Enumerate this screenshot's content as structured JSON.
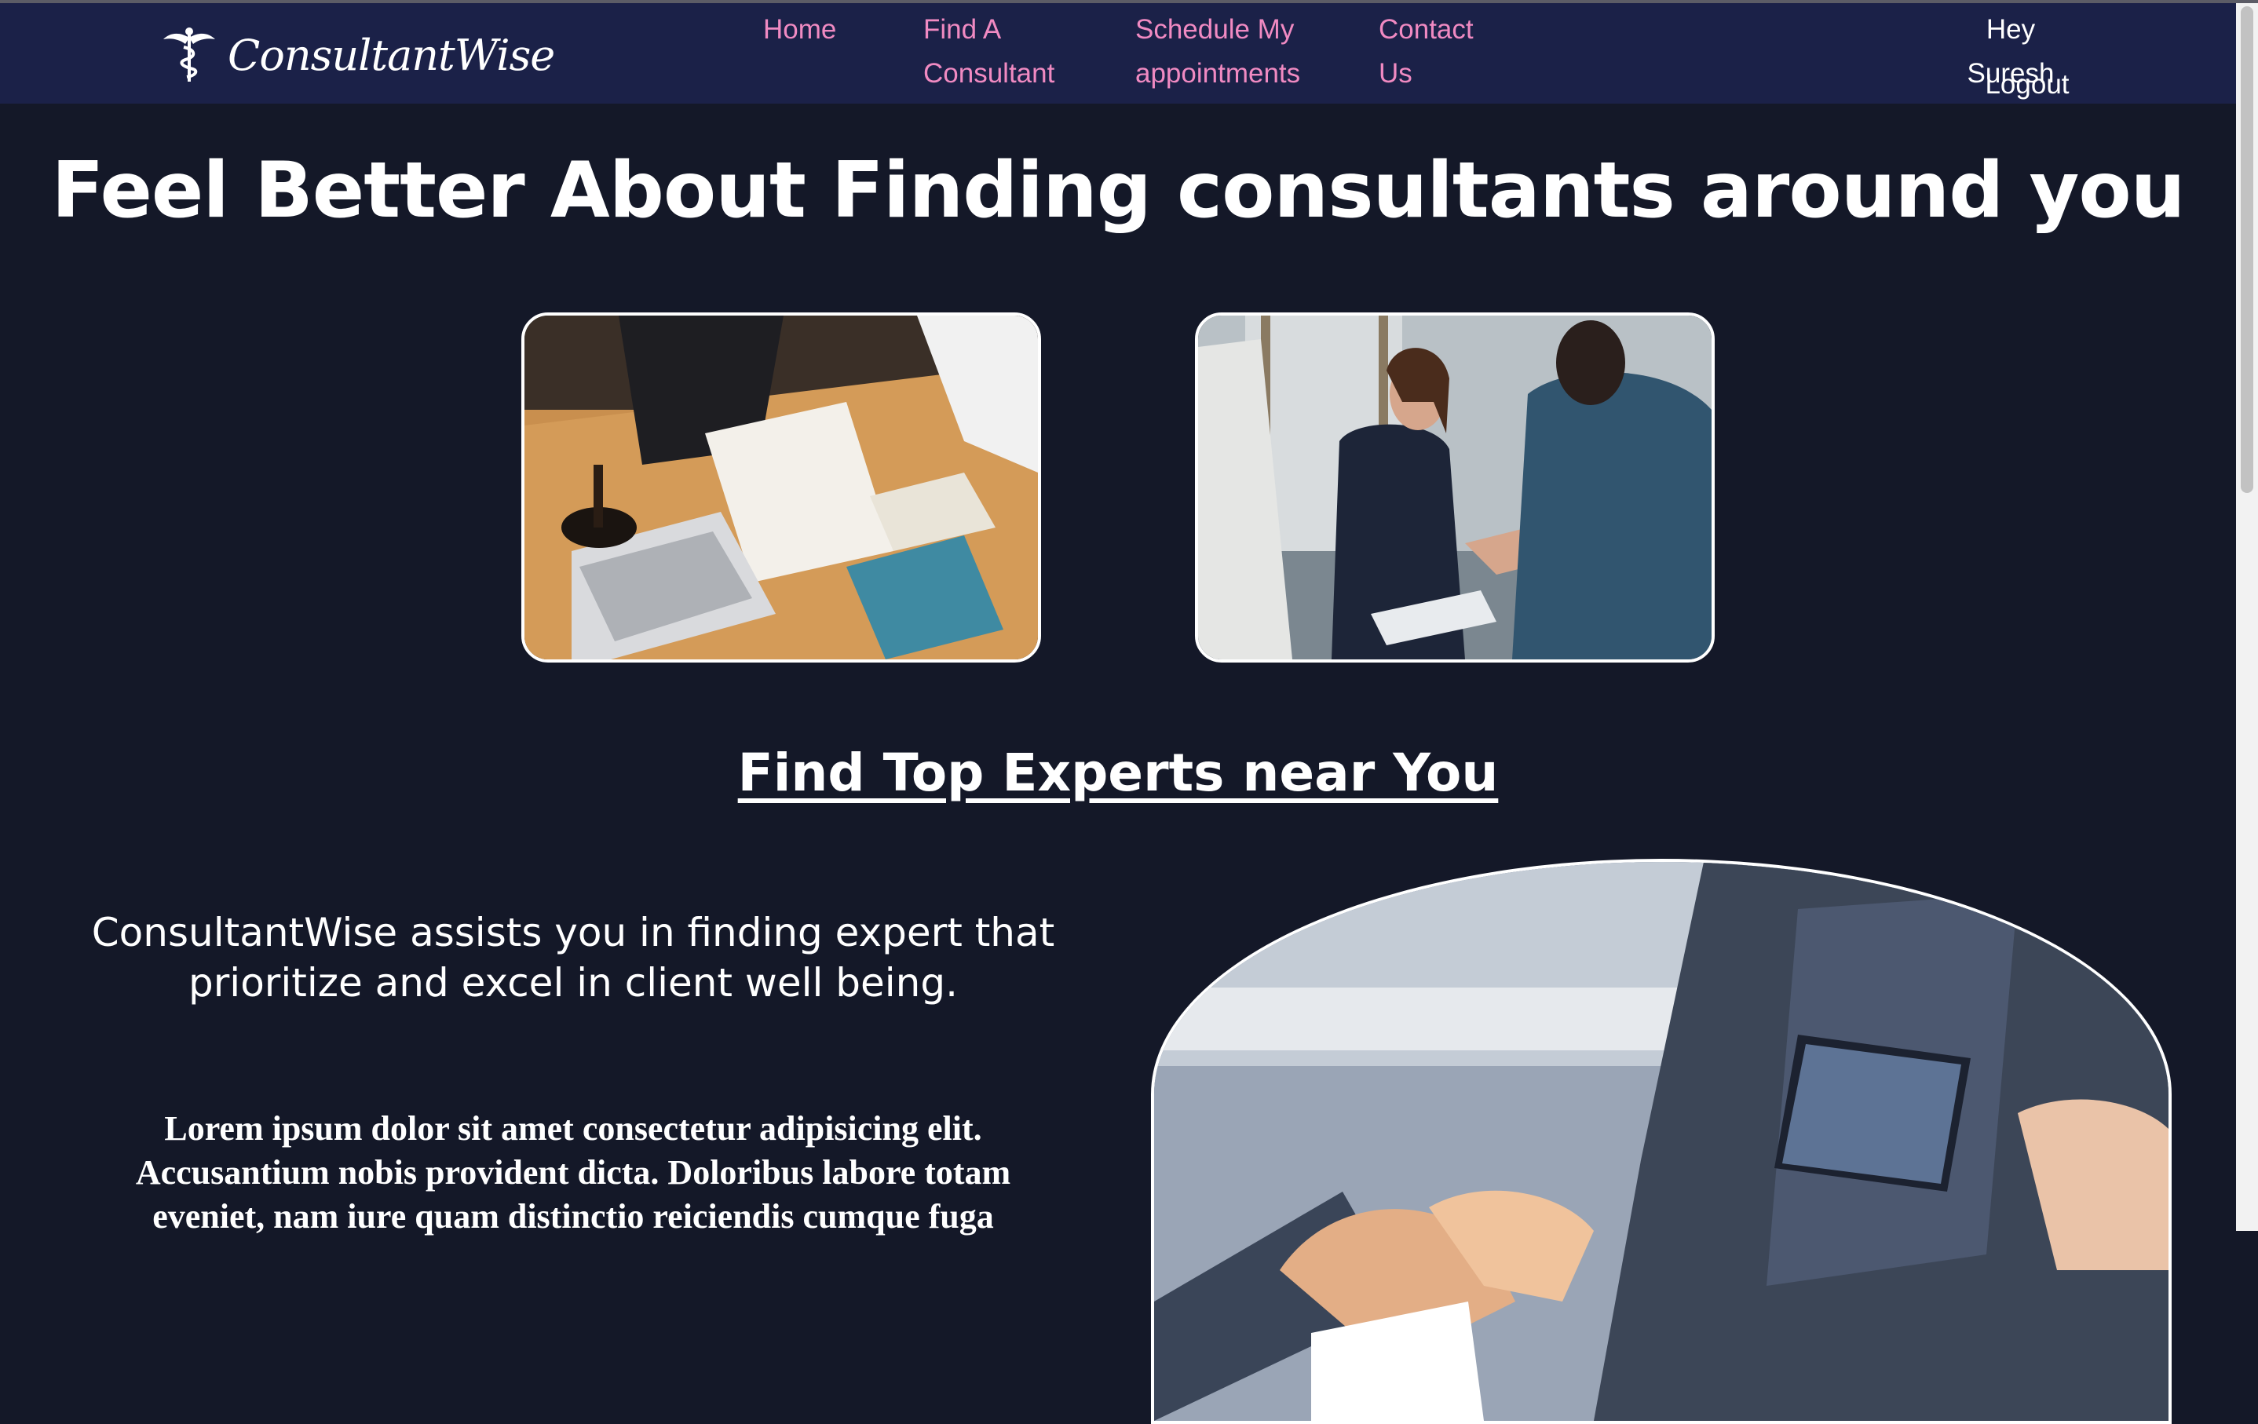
{
  "brand": {
    "name": "ConsultantWise",
    "logo_icon": "caduceus-icon"
  },
  "nav": {
    "home": "Home",
    "find_consultant": "Find A Consultant",
    "schedule": "Schedule My appointments",
    "contact": "Contact Us"
  },
  "user": {
    "greeting": "Hey Suresh",
    "logout": "Logout"
  },
  "hero": {
    "title": "Feel Better About Finding consultants around you"
  },
  "section": {
    "title": "Find Top Experts near You"
  },
  "about": {
    "tagline": "ConsultantWise assists you in finding expert that prioritize and excel in client well being.",
    "body": "Lorem ipsum dolor sit amet consectetur adipisicing elit. Accusantium nobis provident dicta. Doloribus labore totam eveniet, nam iure quam distinctio reiciendis cumque fuga"
  },
  "colors": {
    "page_background": "#141828",
    "navbar_background": "#1b2148",
    "nav_link": "#f08ac2",
    "text": "#ffffff"
  }
}
